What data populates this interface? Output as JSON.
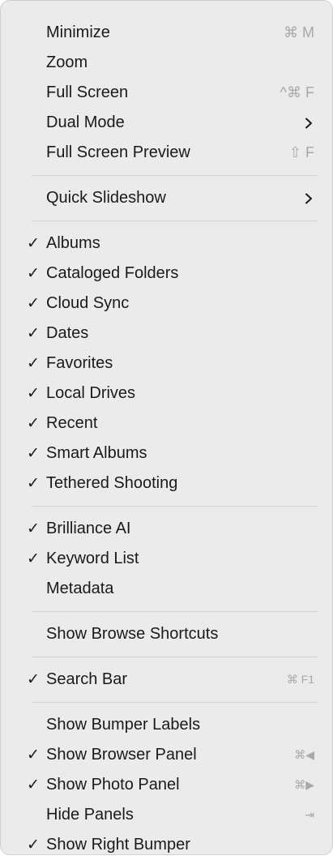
{
  "menu": {
    "window_items": [
      {
        "label": "Minimize",
        "shortcut": "⌘ M"
      },
      {
        "label": "Zoom",
        "shortcut": ""
      },
      {
        "label": "Full Screen",
        "shortcut": "^⌘ F"
      },
      {
        "label": "Dual Mode",
        "submenu": true
      },
      {
        "label": "Full Screen Preview",
        "shortcut": "⇧ F"
      }
    ],
    "slideshow_item": {
      "label": "Quick Slideshow",
      "submenu": true
    },
    "sources": [
      {
        "label": "Albums",
        "checked": true
      },
      {
        "label": "Cataloged Folders",
        "checked": true
      },
      {
        "label": "Cloud Sync",
        "checked": true
      },
      {
        "label": "Dates",
        "checked": true
      },
      {
        "label": "Favorites",
        "checked": true
      },
      {
        "label": "Local Drives",
        "checked": true
      },
      {
        "label": "Recent",
        "checked": true
      },
      {
        "label": "Smart Albums",
        "checked": true
      },
      {
        "label": "Tethered Shooting",
        "checked": true
      }
    ],
    "panels": [
      {
        "label": "Brilliance AI",
        "checked": true
      },
      {
        "label": "Keyword List",
        "checked": true
      },
      {
        "label": "Metadata",
        "checked": false
      }
    ],
    "browse_shortcuts": {
      "label": "Show Browse Shortcuts"
    },
    "search_bar": {
      "label": "Search Bar",
      "checked": true,
      "shortcut": "⌘ F1"
    },
    "bumper_items": [
      {
        "label": "Show Bumper Labels",
        "checked": false,
        "shortcut": ""
      },
      {
        "label": "Show Browser Panel",
        "checked": true,
        "shortcut": "⌘◀"
      },
      {
        "label": "Show Photo Panel",
        "checked": true,
        "shortcut": "⌘▶"
      },
      {
        "label": "Hide Panels",
        "checked": false,
        "shortcut": "⇥"
      },
      {
        "label": "Show Right Bumper",
        "checked": true,
        "shortcut": ""
      }
    ],
    "check_glyph": "✓"
  },
  "colors": {
    "menu_background": "#ebebeb",
    "text": "#1a1a1a",
    "shortcut_text": "#a8a8a8",
    "separator": "#d3d3d3"
  },
  "icons": {
    "submenu": "chevron-right-icon",
    "check": "checkmark-icon"
  }
}
